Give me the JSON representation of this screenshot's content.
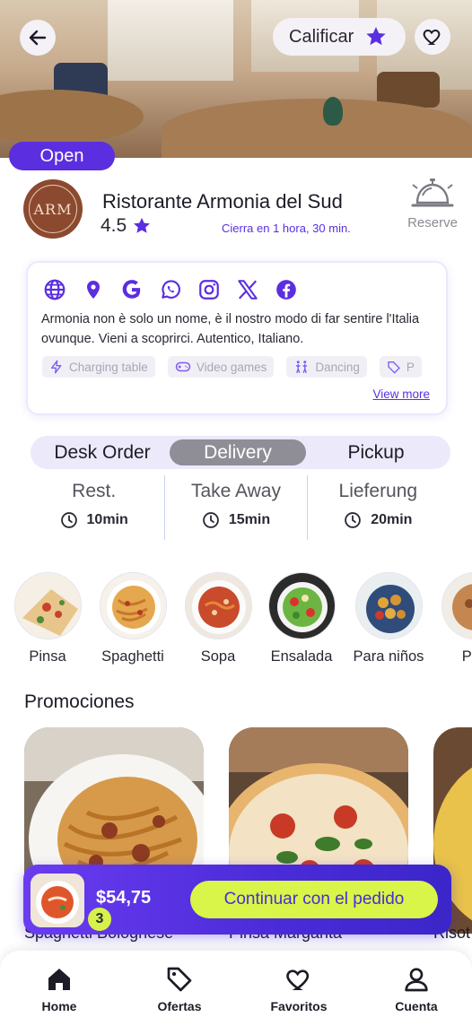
{
  "header": {
    "rate_label": "Calificar",
    "status_badge": "Open"
  },
  "restaurant": {
    "name": "Ristorante Armonia del Sud",
    "rating": "4.5",
    "close_info": "Cierra en 1 hora, 30 min.",
    "reserve_label": "Reserve",
    "logo_text": "ARM"
  },
  "info": {
    "social_icons": [
      "globe-icon",
      "location-pin-icon",
      "google-icon",
      "whatsapp-icon",
      "instagram-icon",
      "x-icon",
      "facebook-icon"
    ],
    "description": "Armonia non è solo un nome, è il nostro modo di far sentire l'Italia ovunque. Vieni a scoprirci. Autentico, Italiano.",
    "tags": [
      {
        "label": "Charging table",
        "icon": "lightning-icon"
      },
      {
        "label": "Video games",
        "icon": "gamepad-icon"
      },
      {
        "label": "Dancing",
        "icon": "dancing-icon"
      },
      {
        "label": "P",
        "icon": "tag-icon"
      }
    ],
    "view_more": "View more"
  },
  "order_tabs": [
    {
      "label": "Desk Order",
      "active": false
    },
    {
      "label": "Delivery",
      "active": true
    },
    {
      "label": "Pickup",
      "active": false
    }
  ],
  "times": [
    {
      "label": "Rest.",
      "value": "10min"
    },
    {
      "label": "Take Away",
      "value": "15min"
    },
    {
      "label": "Lieferung",
      "value": "20min"
    }
  ],
  "categories": [
    "Pinsa",
    "Spaghetti",
    "Sopa",
    "Ensalada",
    "Para niños",
    "Plat"
  ],
  "promotions": {
    "title": "Promociones",
    "items": [
      "Spaghetti Bolognese",
      "Pinsa Margarita",
      "Risot"
    ]
  },
  "cart": {
    "count": "3",
    "total": "$54,75",
    "button_label": "Continuar con el pedido"
  },
  "nav": [
    {
      "label": "Home",
      "icon": "home-icon"
    },
    {
      "label": "Ofertas",
      "icon": "tag-icon"
    },
    {
      "label": "Favoritos",
      "icon": "heart-icon"
    },
    {
      "label": "Cuenta",
      "icon": "user-icon"
    }
  ],
  "colors": {
    "primary": "#5b2ee0",
    "accent": "#d9f549",
    "tab_active": "#8f8d96"
  }
}
